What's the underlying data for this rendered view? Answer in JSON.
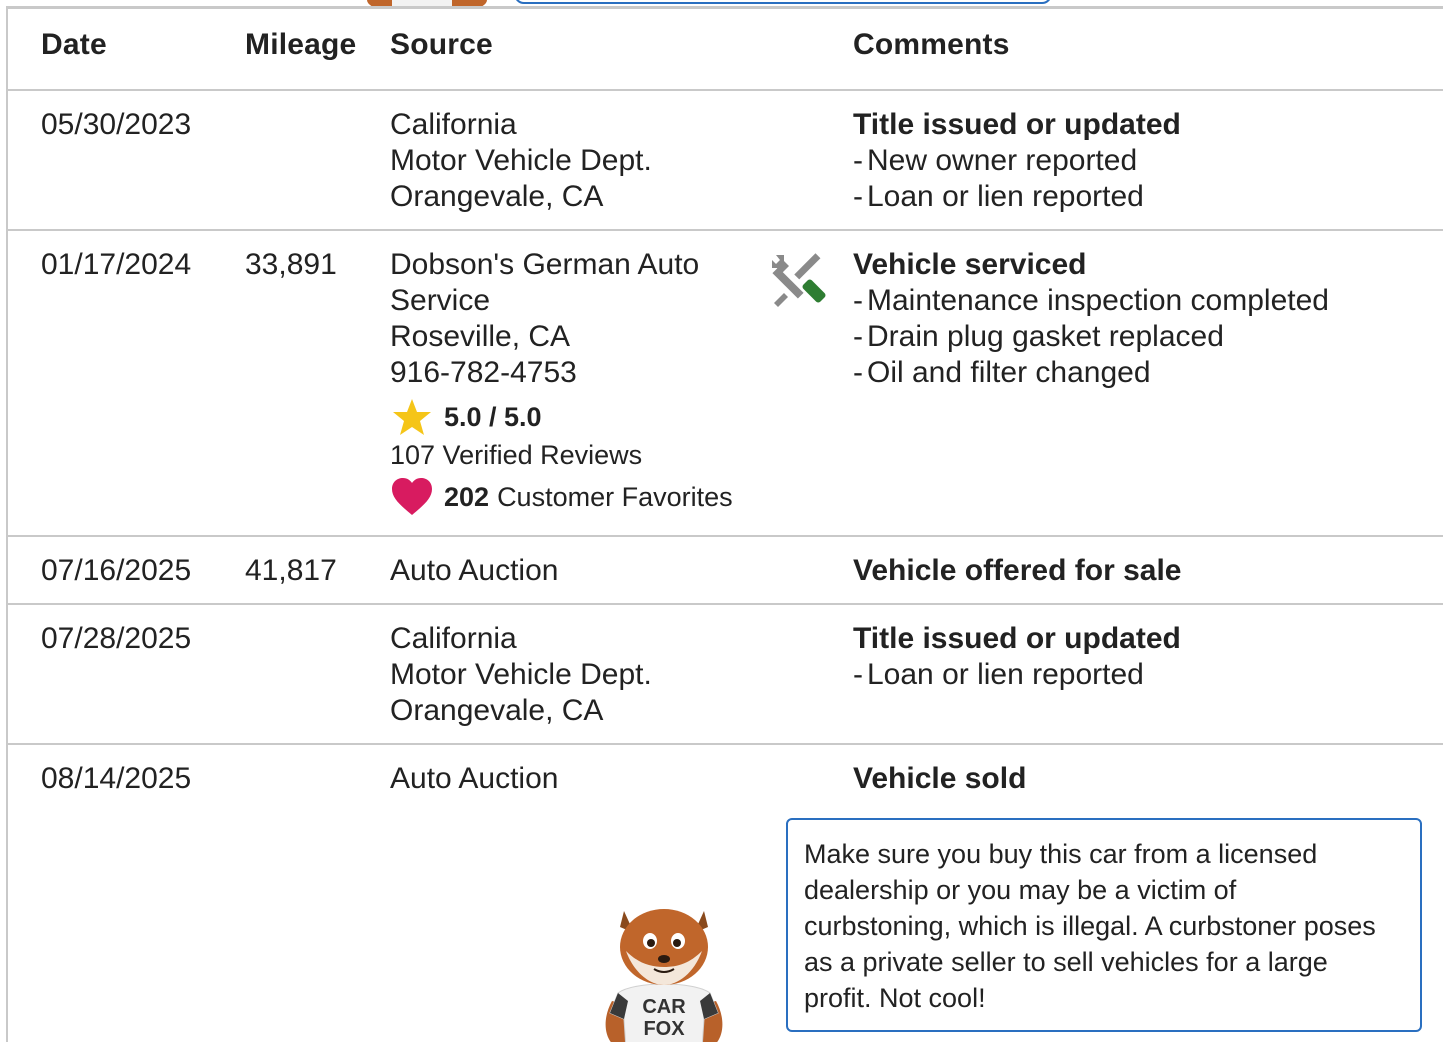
{
  "columns": {
    "date": "Date",
    "mileage": "Mileage",
    "source": "Source",
    "comments": "Comments"
  },
  "records": [
    {
      "date": "05/30/2023",
      "mileage": "",
      "source": [
        "California",
        "Motor Vehicle Dept.",
        "Orangevale, CA"
      ],
      "comment_title": "Title issued or updated",
      "comment_items": [
        "New owner reported",
        "Loan or lien reported"
      ]
    },
    {
      "date": "01/17/2024",
      "mileage": "33,891",
      "source": [
        "Dobson's German Auto",
        "Service",
        "Roseville, CA",
        "916-782-4753"
      ],
      "rating": "5.0 / 5.0",
      "reviews": "107 Verified Reviews",
      "favorites_count": "202",
      "favorites_label": "Customer Favorites",
      "icon": "service-tools-icon",
      "comment_title": "Vehicle serviced",
      "comment_items": [
        "Maintenance inspection completed",
        "Drain plug gasket replaced",
        "Oil and filter changed"
      ]
    },
    {
      "date": "07/16/2025",
      "mileage": "41,817",
      "source": [
        "Auto Auction"
      ],
      "comment_title": "Vehicle offered for sale",
      "comment_items": []
    },
    {
      "date": "07/28/2025",
      "mileage": "",
      "source": [
        "California",
        "Motor Vehicle Dept.",
        "Orangevale, CA"
      ],
      "comment_title": "Title issued or updated",
      "comment_items": [
        "Loan or lien reported"
      ]
    },
    {
      "date": "08/14/2025",
      "mileage": "",
      "source": [
        "Auto Auction"
      ],
      "comment_title": "Vehicle sold",
      "comment_items": []
    }
  ],
  "callout": {
    "lines": [
      "Make sure you buy this car from a licensed",
      "dealership or you may be a victim of",
      "curbstoning, which is illegal. A curbstoner poses",
      "as a private seller to sell vehicles for a large",
      "profit. Not cool!"
    ]
  },
  "mascot": {
    "shirt_line1": "CAR",
    "shirt_line2": "FOX"
  },
  "colors": {
    "border": "#c9c9c9",
    "callout_border": "#2a6fc0",
    "star": "#f5c518",
    "heart": "#d81b60",
    "wrench_grey": "#8a8a8a",
    "screwdriver_green": "#2e7d32"
  }
}
